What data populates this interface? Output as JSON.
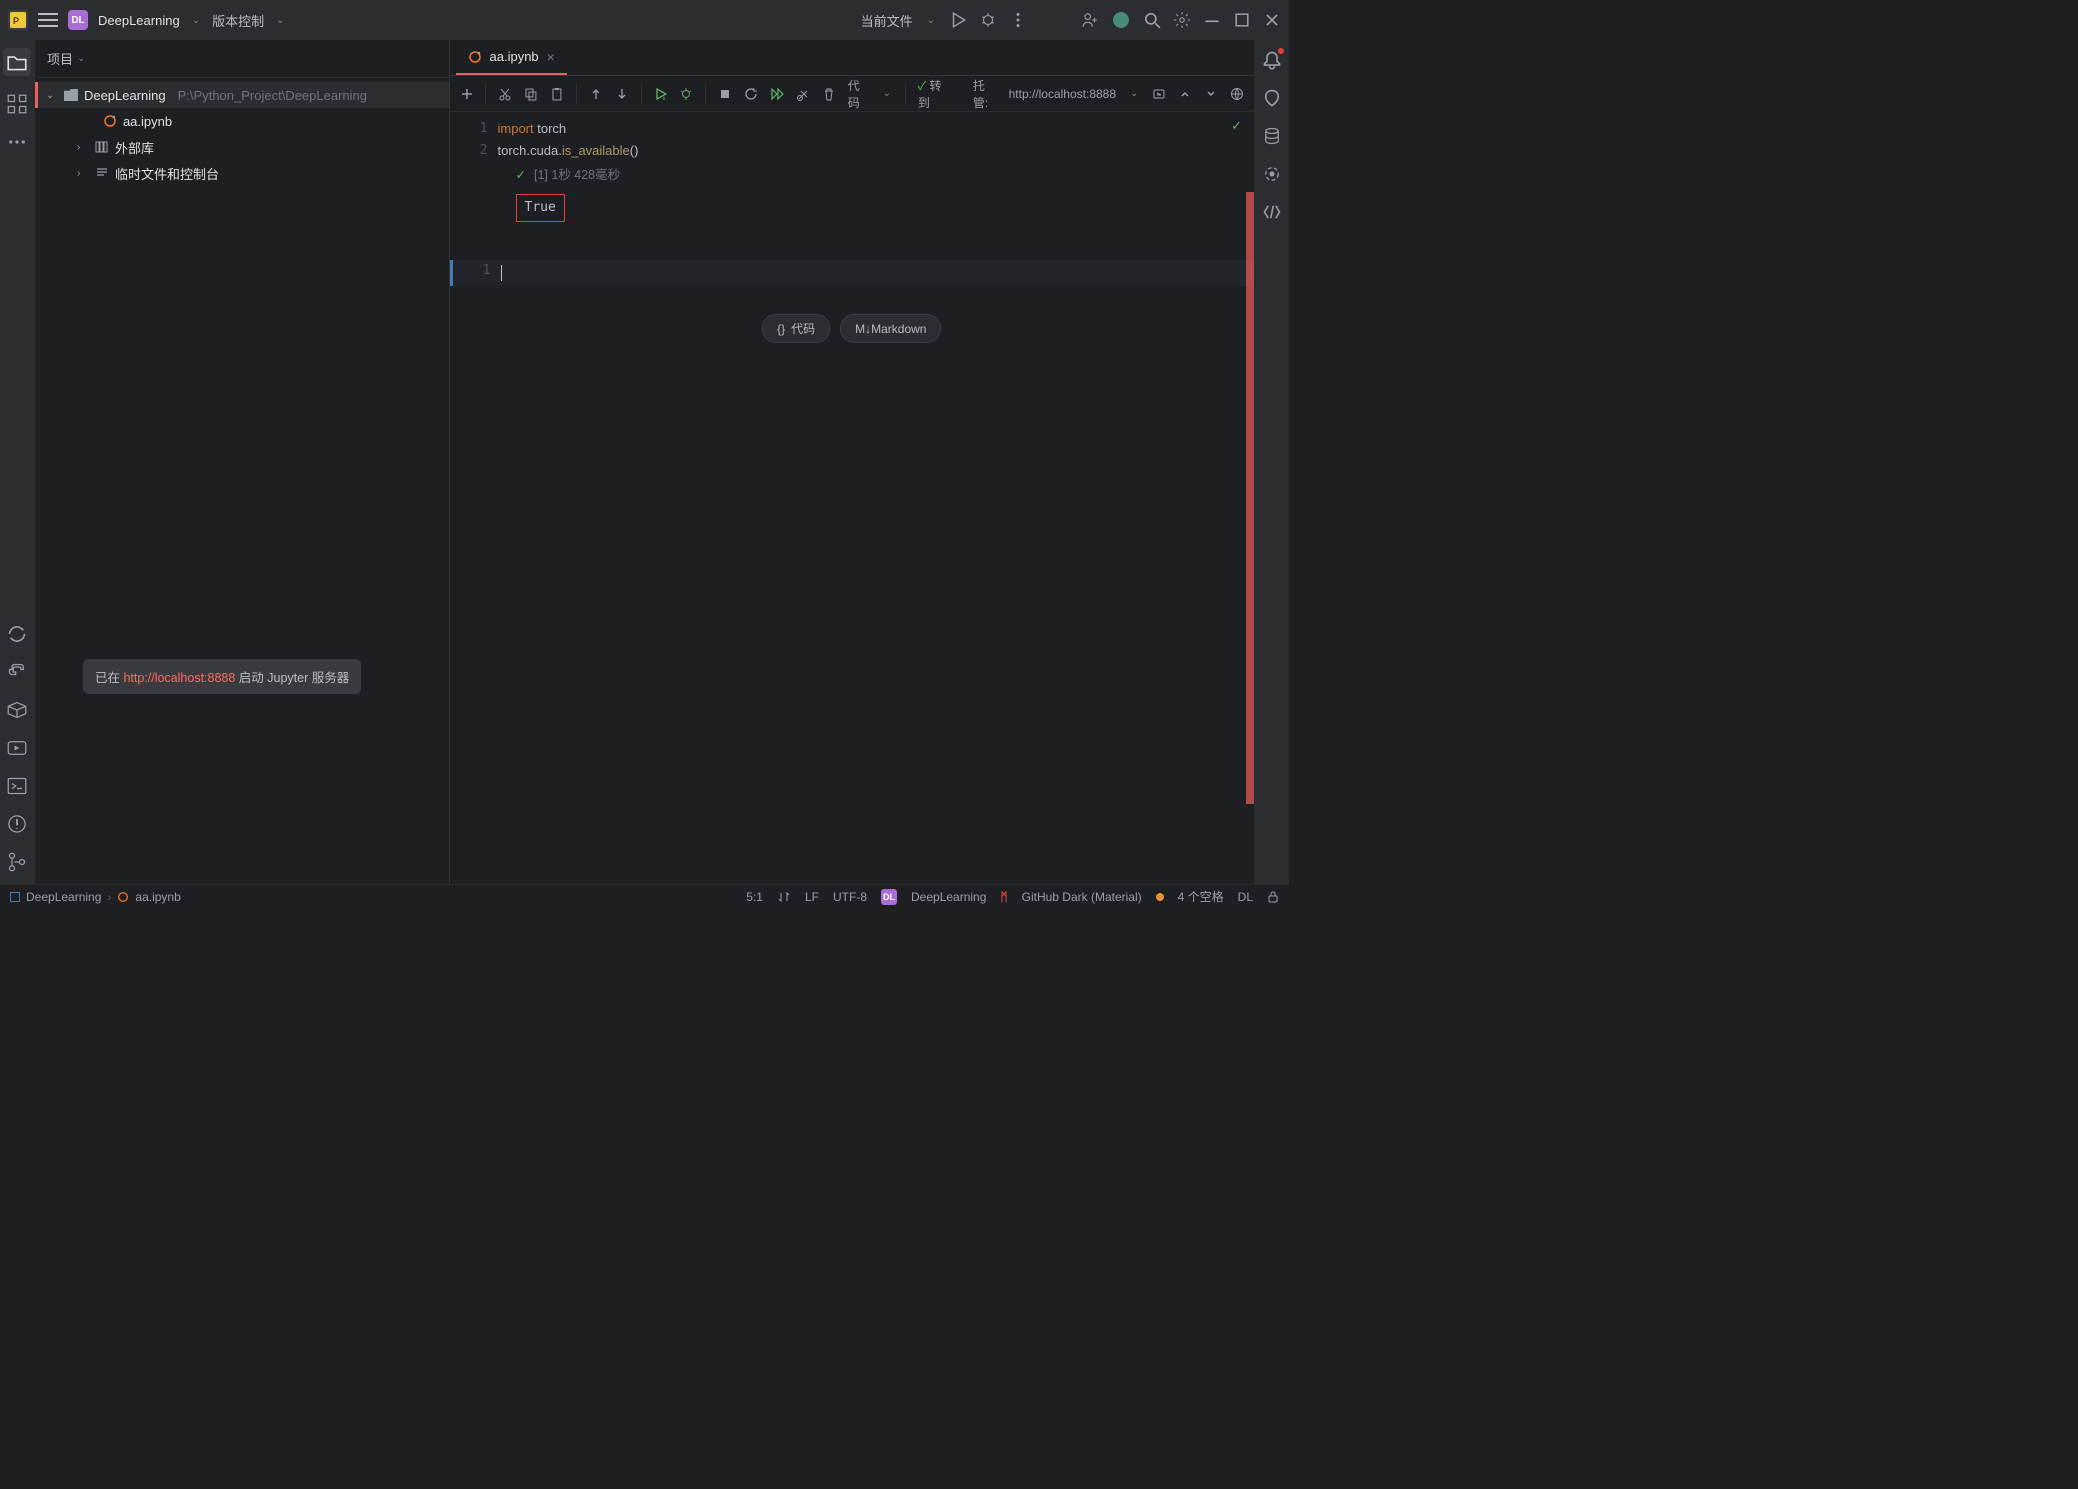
{
  "titlebar": {
    "project": "DeepLearning",
    "vcs": "版本控制",
    "current_file": "当前文件"
  },
  "project_panel": {
    "title": "项目",
    "root_name": "DeepLearning",
    "root_path": "P:\\Python_Project\\DeepLearning",
    "file1": "aa.ipynb",
    "ext_libs": "外部库",
    "scratches": "临时文件和控制台"
  },
  "popup": {
    "prefix": "已在 ",
    "url": "http://localhost:8888",
    "suffix": " 启动 Jupyter 服务器"
  },
  "tab": {
    "name": "aa.ipynb"
  },
  "nb_toolbar": {
    "code_label": "代码",
    "goto_label": "转到",
    "trust_label": "托管:",
    "host": "http://localhost:8888"
  },
  "cell1": {
    "line1_kw": "import",
    "line1_mod": " torch",
    "line2_a": "torch.cuda.",
    "line2_fn": "is_available",
    "line2_b": "()",
    "exec": "[1] 1秒 428毫秒",
    "output": "True"
  },
  "cell_buttons": {
    "code": "代码",
    "md": "M↓Markdown"
  },
  "breadcrumb": {
    "a": "DeepLearning",
    "b": "aa.ipynb"
  },
  "status": {
    "pos": "5:1",
    "lf": "LF",
    "enc": "UTF-8",
    "proj": "DeepLearning",
    "theme": "GitHub Dark (Material)",
    "spaces": "4 个空格",
    "dl": "DL"
  }
}
